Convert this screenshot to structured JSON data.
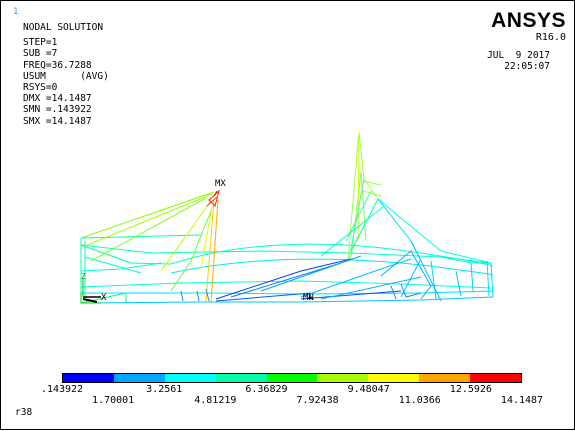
{
  "window_number": "1",
  "info": {
    "title": "NODAL SOLUTION",
    "step": "STEP=1",
    "sub": "SUB =7",
    "freq": "FREQ=36.7288",
    "result": "USUM      (AVG)",
    "rsys": "RSYS=0",
    "dmx": "DMX =14.1487",
    "smn": "SMN =.143922",
    "smx": "SMX =14.1487"
  },
  "brand": "ANSYS",
  "version": "R16.0",
  "date": "JUL  9 2017",
  "time": "22:05:07",
  "markers": {
    "max": "MX",
    "min": "MN",
    "x_axis": "X",
    "z_axis": "Z"
  },
  "legend": {
    "colors": [
      "#0000ff",
      "#00a7ff",
      "#00ffff",
      "#00ffa7",
      "#00ff00",
      "#a7ff00",
      "#ffff00",
      "#ffa700",
      "#ff0000"
    ],
    "ticks": [
      ".143922",
      "1.70001",
      "3.2561",
      "4.81219",
      "6.36829",
      "7.92438",
      "9.48047",
      "11.0366",
      "12.5926",
      "14.1487"
    ]
  },
  "footer": "r38"
}
